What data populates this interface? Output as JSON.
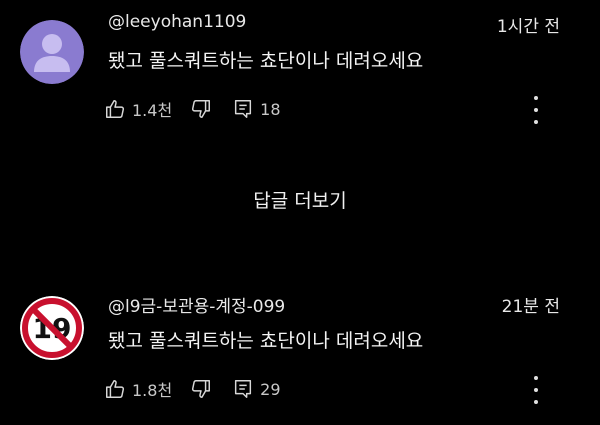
{
  "comments": [
    {
      "handle": "@leeyohan1109",
      "time": "1시간 전",
      "text": "됐고 풀스쿼트하는 쵸단이나 데려오세요",
      "avatar_icon": "default-user-avatar",
      "likes": "1.4천",
      "replies": "18"
    },
    {
      "handle": "@l9금-보관용-계정-099",
      "time": "21분 전",
      "text": "됐고 풀스쿼트하는 쵸단이나 데려오세요",
      "avatar_icon": "age-19-restricted-avatar",
      "likes": "1.8천",
      "replies": "29"
    }
  ],
  "more_replies_label": "답글 더보기",
  "colors": {
    "background": "#000000",
    "default_avatar": "#8a7bd0",
    "restricted_red": "#c8102e"
  }
}
